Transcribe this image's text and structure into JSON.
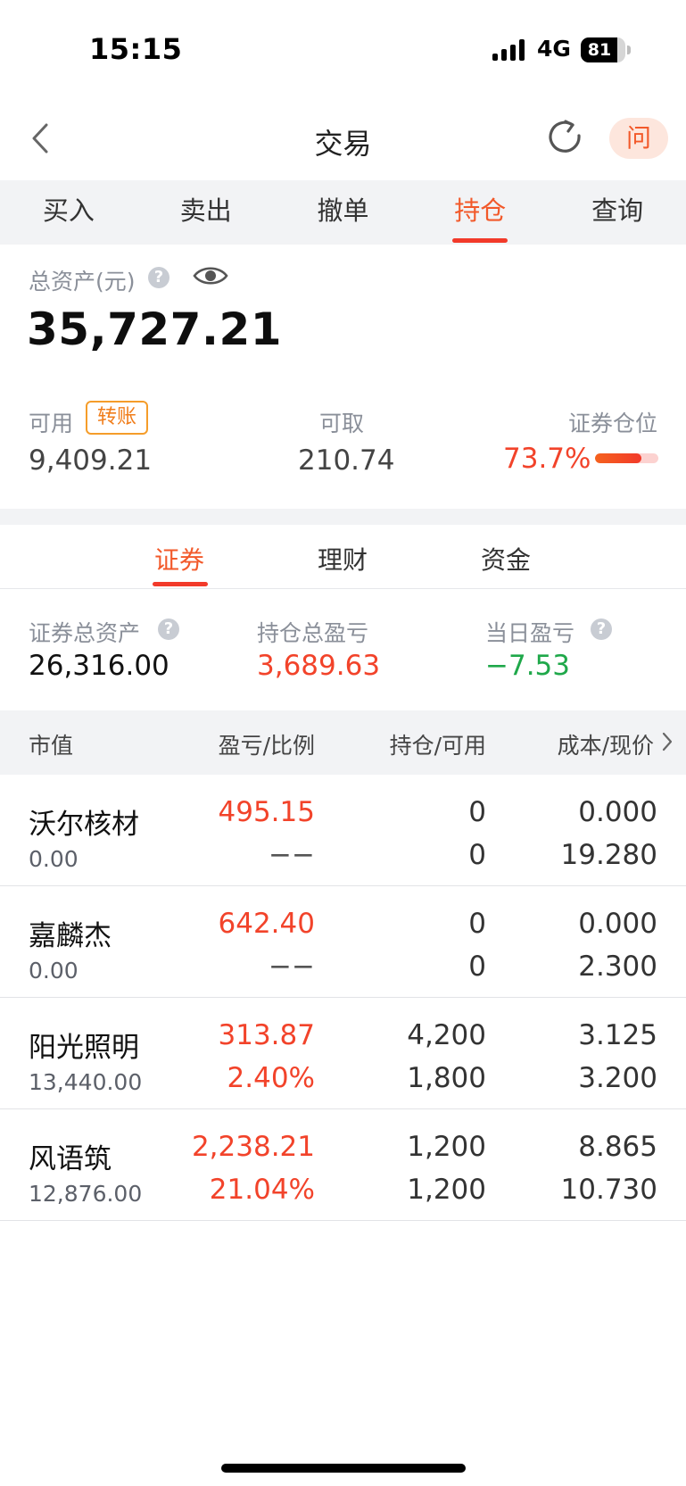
{
  "status_bar": {
    "time": "15:15",
    "network": "4G",
    "battery": "81"
  },
  "nav": {
    "title": "交易",
    "ask_label": "问"
  },
  "top_tabs": [
    {
      "label": "买入"
    },
    {
      "label": "卖出"
    },
    {
      "label": "撤单"
    },
    {
      "label": "持仓",
      "active": true
    },
    {
      "label": "查询"
    }
  ],
  "assets": {
    "total_label": "总资产(元)",
    "total_value": "35,727.21",
    "available_label": "可用",
    "transfer_label": "转账",
    "available_value": "9,409.21",
    "withdrawable_label": "可取",
    "withdrawable_value": "210.74",
    "position_label": "证券仓位",
    "position_value": "73.7%",
    "position_fraction": 0.737
  },
  "sub_tabs": [
    {
      "label": "证券",
      "active": true
    },
    {
      "label": "理财"
    },
    {
      "label": "资金"
    }
  ],
  "securities_summary": {
    "total_label": "证券总资产",
    "total_value": "26,316.00",
    "pl_label": "持仓总盈亏",
    "pl_value": "3,689.63",
    "daily_label": "当日盈亏",
    "daily_value": "−7.53"
  },
  "table": {
    "headers": [
      "市值",
      "盈亏/比例",
      "持仓/可用",
      "成本/现价"
    ],
    "rows": [
      {
        "name": "沃尔核材",
        "market_value": "0.00",
        "pl": "495.15",
        "ratio": "−−",
        "position": "0",
        "available": "0",
        "cost": "0.000",
        "price": "19.280"
      },
      {
        "name": "嘉麟杰",
        "market_value": "0.00",
        "pl": "642.40",
        "ratio": "−−",
        "position": "0",
        "available": "0",
        "cost": "0.000",
        "price": "2.300"
      },
      {
        "name": "阳光照明",
        "market_value": "13,440.00",
        "pl": "313.87",
        "ratio": "2.40%",
        "position": "4,200",
        "available": "1,800",
        "cost": "3.125",
        "price": "3.200"
      },
      {
        "name": "风语筑",
        "market_value": "12,876.00",
        "pl": "2,238.21",
        "ratio": "21.04%",
        "position": "1,200",
        "available": "1,200",
        "cost": "8.865",
        "price": "10.730"
      }
    ]
  },
  "colors": {
    "accent": "#f2592a",
    "gain": "#f2432a",
    "loss": "#1fa84a",
    "transfer": "#f07d1a"
  },
  "icons": [
    "back-chevron-icon",
    "refresh-icon",
    "help-icon",
    "eye-icon",
    "chevron-right-icon"
  ]
}
